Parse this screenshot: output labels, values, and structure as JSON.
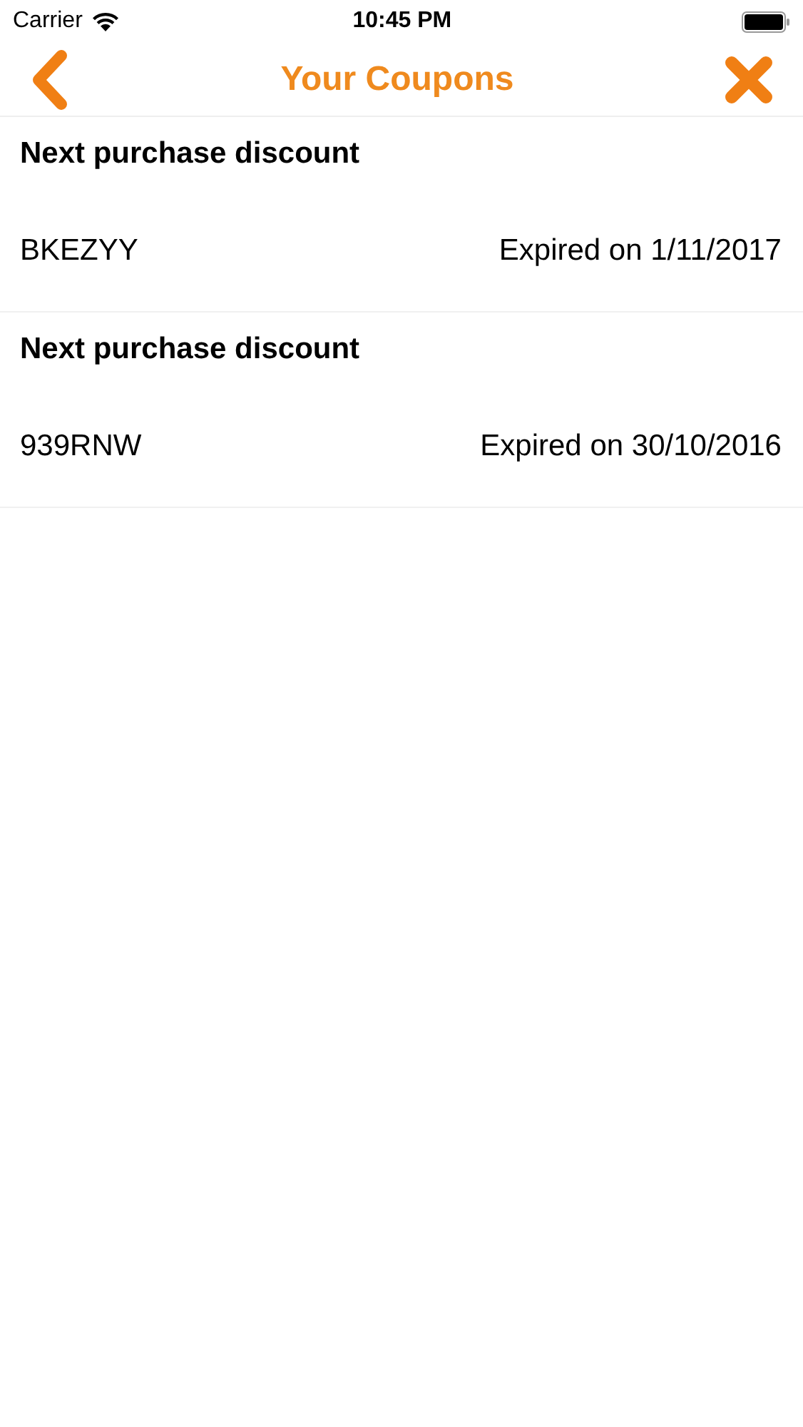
{
  "status_bar": {
    "carrier": "Carrier",
    "time": "10:45 PM"
  },
  "nav_bar": {
    "title": "Your Coupons"
  },
  "coupons": [
    {
      "title": "Next purchase discount",
      "code": "BKEZYY",
      "expiry": "Expired on 1/11/2017"
    },
    {
      "title": "Next purchase discount",
      "code": "939RNW",
      "expiry": "Expired on 30/10/2016"
    }
  ]
}
